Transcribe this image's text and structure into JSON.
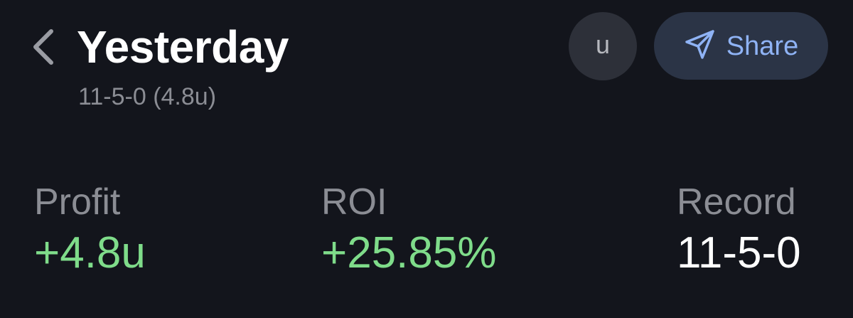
{
  "header": {
    "title": "Yesterday",
    "subtitle": "11-5-0 (4.8u)",
    "back_icon": "chevron-left-icon",
    "unit_button_label": "u",
    "share_button": {
      "label": "Share",
      "icon": "send-icon"
    }
  },
  "stats": {
    "profit": {
      "label": "Profit",
      "value": "+4.8u"
    },
    "roi": {
      "label": "ROI",
      "value": "+25.85%"
    },
    "record": {
      "label": "Record",
      "value": "11-5-0"
    }
  },
  "colors": {
    "background": "#13151c",
    "positive": "#7fdc8a",
    "accent": "#8fb3f5",
    "muted": "#8b8d94"
  }
}
